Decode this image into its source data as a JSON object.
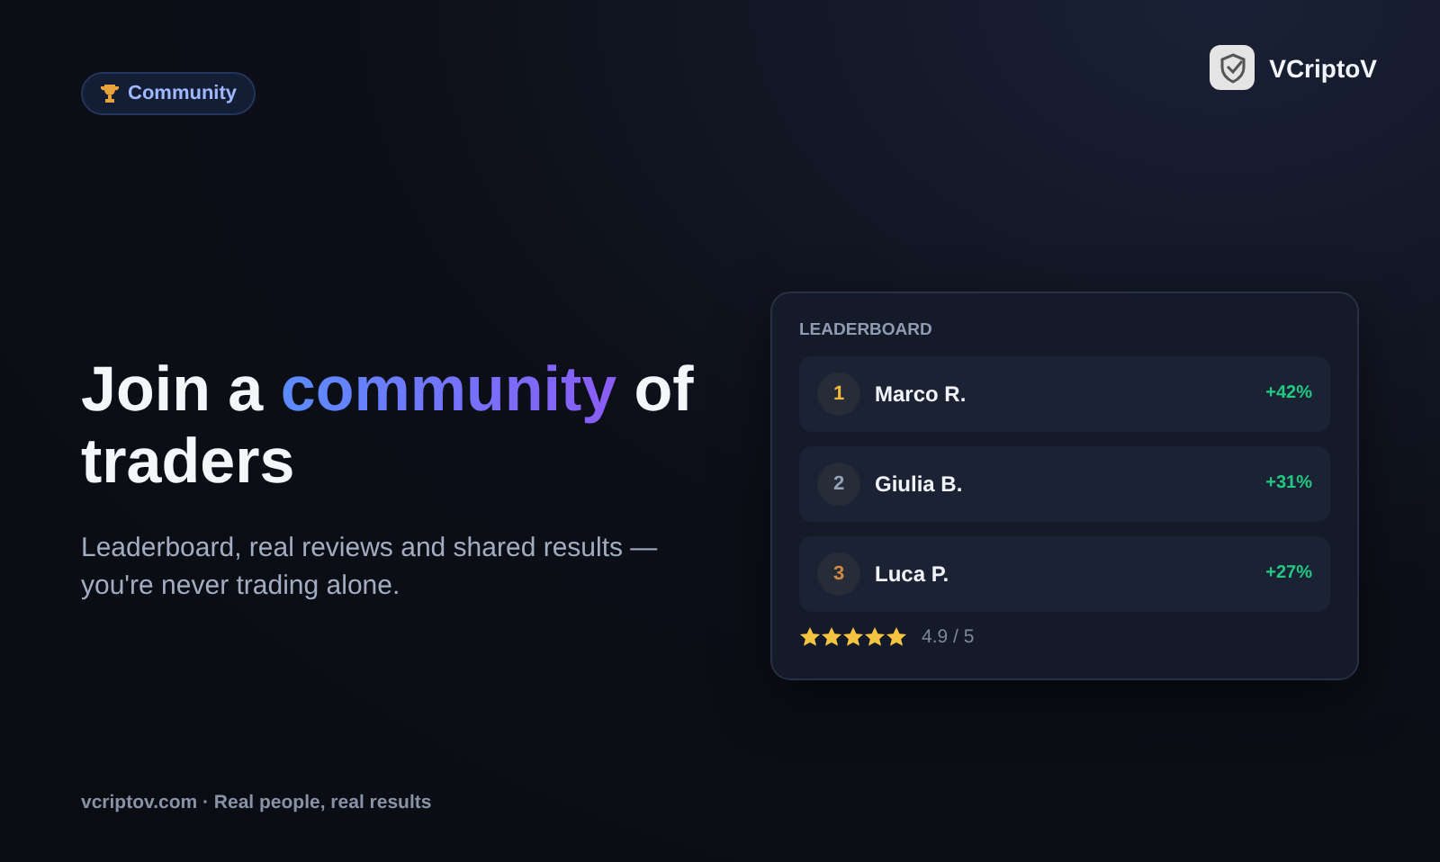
{
  "badge": {
    "label": "Community"
  },
  "brand": {
    "name": "VCriptoV"
  },
  "headline": {
    "before": "Join a ",
    "highlight": "community",
    "after": " of traders"
  },
  "subtitle": "Leaderboard, real reviews and shared results — you're never trading alone.",
  "leaderboard": {
    "title": "LEADERBOARD",
    "rows": [
      {
        "rank": "1",
        "name": "Marco R.",
        "gain": "+42%",
        "color": "#f5b63c"
      },
      {
        "rank": "2",
        "name": "Giulia B.",
        "gain": "+31%",
        "color": "#94a3b8"
      },
      {
        "rank": "3",
        "name": "Luca P.",
        "gain": "+27%",
        "color": "#d08a45"
      }
    ],
    "stars": 5,
    "rating": "4.9 / 5"
  },
  "footer": "vcriptov.com · Real people, real results"
}
